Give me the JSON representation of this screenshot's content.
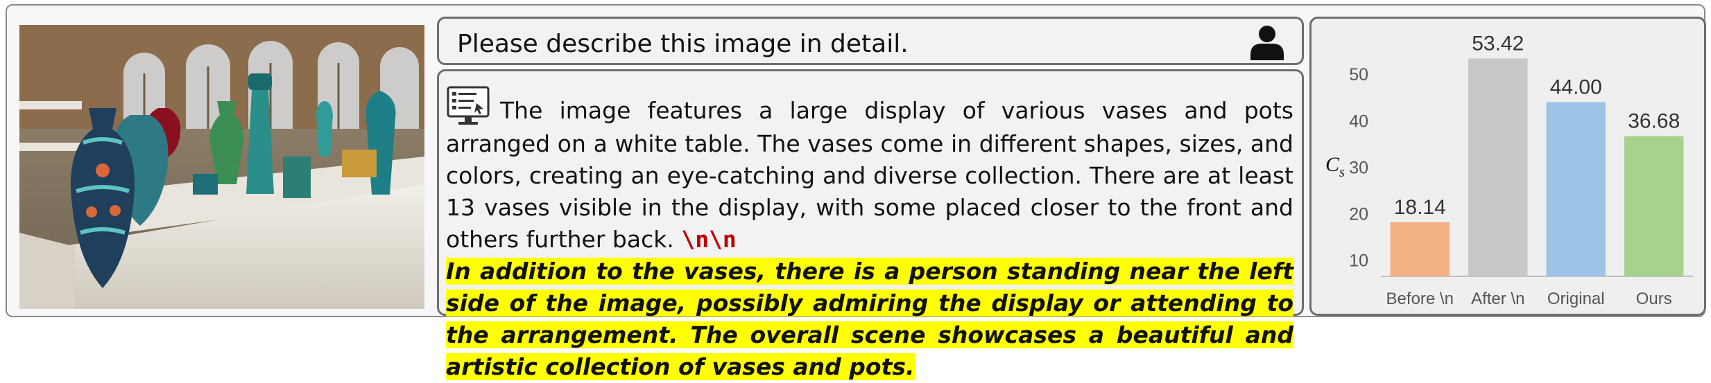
{
  "question": {
    "text": "Please describe this image in detail."
  },
  "answer": {
    "plain": "The image features a large display of various vases and pots arranged on a white table. The vases come in different shapes, sizes, and colors, creating an eye-catching and diverse collection. There are at least 13 vases visible in the display, with some placed closer to the front and others further back. ",
    "newline_token": "\\n\\n",
    "highlighted": "In addition to the vases, there is a person standing near the left side of the image, possibly admiring the display or attending to the arrangement. The overall scene showcases a beautiful and artistic collection of vases and pots."
  },
  "icons": {
    "user": "user-icon",
    "assistant": "monitor-chat-icon"
  },
  "chart_data": {
    "type": "bar",
    "categories": [
      "Before \\n",
      "After \\n",
      "Original",
      "Ours"
    ],
    "values": [
      18.14,
      53.42,
      44.0,
      36.68
    ],
    "value_labels": [
      "18.14",
      "53.42",
      "44.00",
      "36.68"
    ],
    "colors": [
      "#f4b183",
      "#c8c8c8",
      "#9dc3e6",
      "#a9d18e"
    ],
    "ylabel": "C_s",
    "ylim": [
      6.5,
      56
    ],
    "yticks": [
      10,
      20,
      30,
      40,
      50
    ],
    "grid": false
  }
}
